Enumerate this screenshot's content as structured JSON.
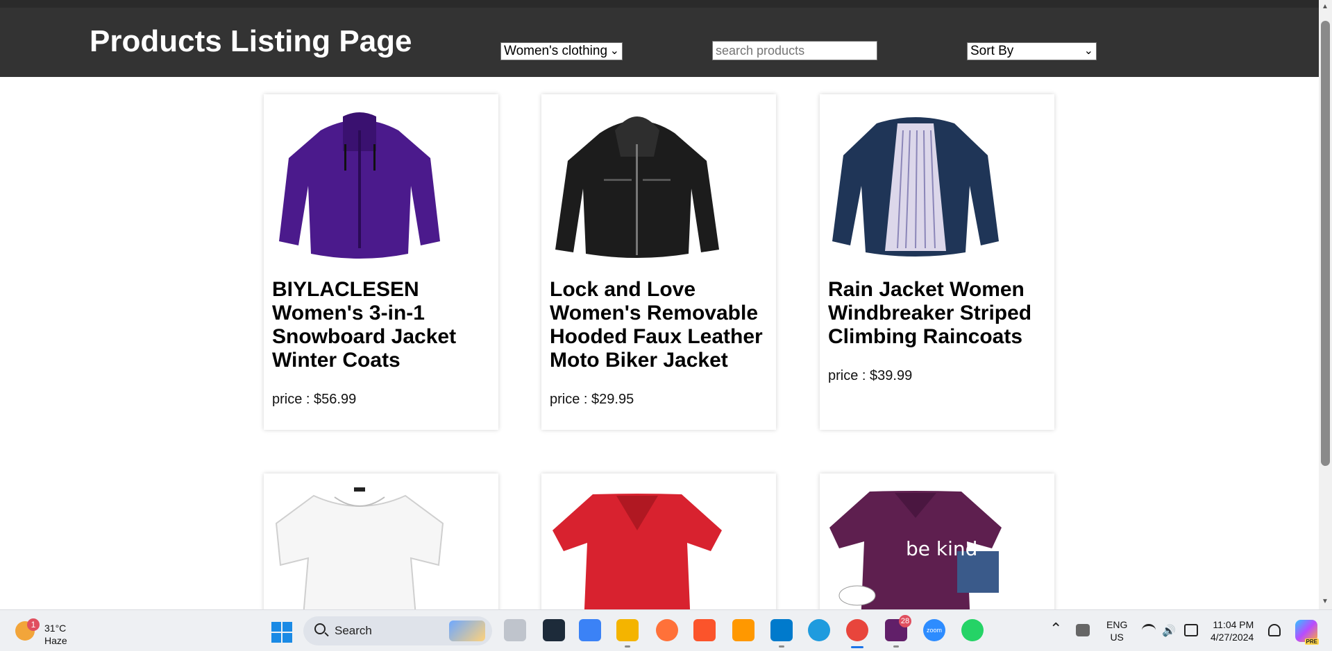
{
  "header": {
    "title": "Products Listing Page",
    "category_selected": "Women's clothing",
    "search_placeholder": "search products",
    "sort_selected": "Sort By"
  },
  "products": [
    {
      "name": "BIYLACLESEN Women's 3-in-1 Snowboard Jacket Winter Coats",
      "price": "price : $56.99",
      "color": "#4b1a8c"
    },
    {
      "name": "Lock and Love Women's Removable Hooded Faux Leather Moto Biker Jacket",
      "price": "price : $29.95",
      "color": "#1c1c1c"
    },
    {
      "name": "Rain Jacket Women Windbreaker Striped Climbing Raincoats",
      "price": "price : $39.99",
      "color": "#1f3557"
    },
    {
      "name": "",
      "price": "",
      "color": "#f4f4f4"
    },
    {
      "name": "",
      "price": "",
      "color": "#d8222f"
    },
    {
      "name": "",
      "price": "",
      "color": "#5e1f4f",
      "print": "be kind"
    }
  ],
  "taskbar": {
    "weather_temp": "31°C",
    "weather_cond": "Haze",
    "weather_badge": "1",
    "search_label": "Search",
    "slack_badge": "28",
    "zoom_label": "zoom",
    "lang_line1": "ENG",
    "lang_line2": "US",
    "time": "11:04 PM",
    "date": "4/27/2024",
    "copilot_label": "PRE"
  }
}
